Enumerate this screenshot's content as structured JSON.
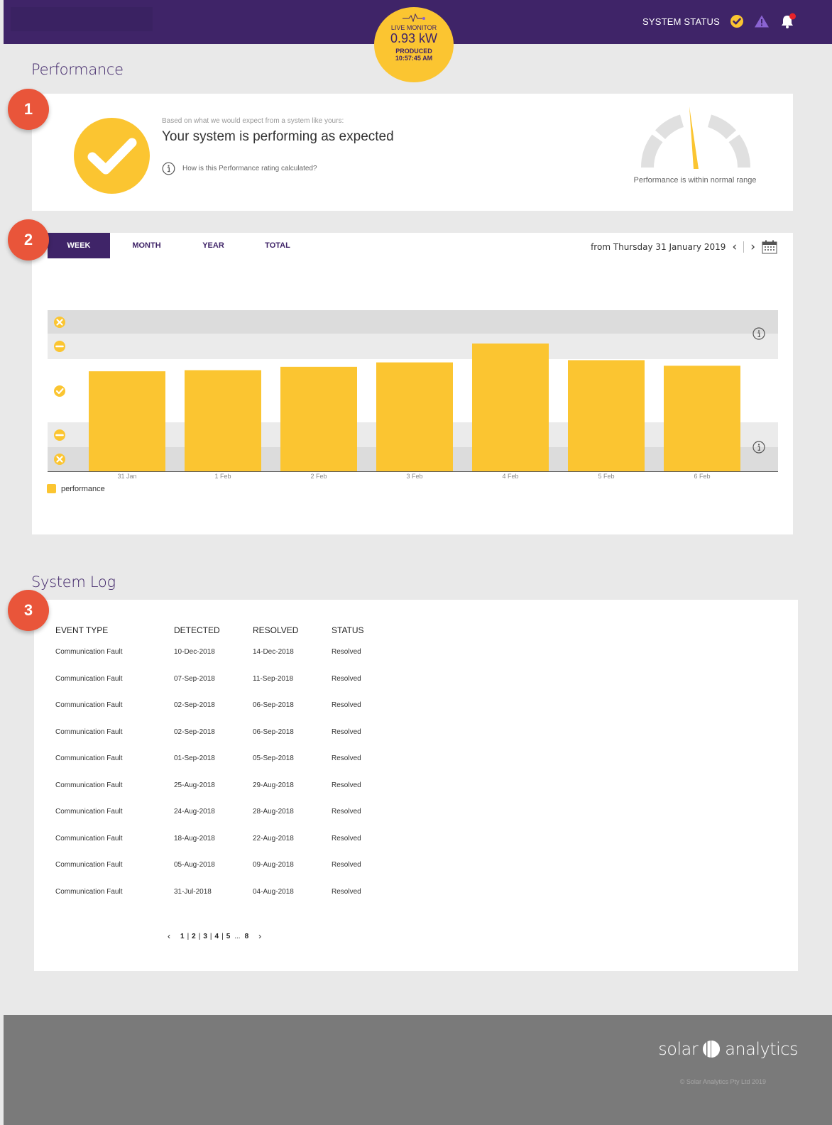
{
  "header": {
    "system_status_label": "SYSTEM STATUS",
    "live_monitor": {
      "label": "LIVE MONITOR",
      "value": "0.93 kW",
      "produced_label": "PRODUCED",
      "time": "10:57:45 AM"
    }
  },
  "performance": {
    "section_title": "Performance",
    "badge": "1",
    "subtitle": "Based on what we would expect from a system like yours:",
    "headline": "Your system is performing as expected",
    "rating_link": "How is this Performance rating calculated?",
    "gauge_caption": "Performance is within normal range"
  },
  "chart_section": {
    "badge": "2",
    "tabs": [
      {
        "label": "WEEK",
        "active": true
      },
      {
        "label": "MONTH",
        "active": false
      },
      {
        "label": "YEAR",
        "active": false
      },
      {
        "label": "TOTAL",
        "active": false
      }
    ],
    "range_text": "from Thursday 31 January 2019",
    "legend": "performance"
  },
  "chart_data": {
    "type": "bar",
    "categories": [
      "31 Jan",
      "1 Feb",
      "2 Feb",
      "3 Feb",
      "4 Feb",
      "5 Feb",
      "6 Feb"
    ],
    "series": [
      {
        "name": "performance",
        "values": [
          0.9,
          0.91,
          0.94,
          0.98,
          1.15,
          1.0,
          0.95
        ]
      }
    ],
    "bands": [
      "poor",
      "below",
      "expected",
      "below",
      "poor"
    ],
    "bands_labeled_on_axis": "status icons (x, minus, check, minus, x)",
    "ylim": [
      0,
      1.45
    ],
    "colors": {
      "bar": "#fbc531",
      "band_outer": "#dcdcdc",
      "band_inner": "#ebebeb"
    },
    "legend": "bottom-left"
  },
  "system_log": {
    "section_title": "System Log",
    "badge": "3",
    "columns": [
      "EVENT TYPE",
      "DETECTED",
      "RESOLVED",
      "STATUS"
    ],
    "rows": [
      [
        "Communication Fault",
        "10-Dec-2018",
        "14-Dec-2018",
        "Resolved"
      ],
      [
        "Communication Fault",
        "07-Sep-2018",
        "11-Sep-2018",
        "Resolved"
      ],
      [
        "Communication Fault",
        "02-Sep-2018",
        "06-Sep-2018",
        "Resolved"
      ],
      [
        "Communication Fault",
        "02-Sep-2018",
        "06-Sep-2018",
        "Resolved"
      ],
      [
        "Communication Fault",
        "01-Sep-2018",
        "05-Sep-2018",
        "Resolved"
      ],
      [
        "Communication Fault",
        "25-Aug-2018",
        "29-Aug-2018",
        "Resolved"
      ],
      [
        "Communication Fault",
        "24-Aug-2018",
        "28-Aug-2018",
        "Resolved"
      ],
      [
        "Communication Fault",
        "18-Aug-2018",
        "22-Aug-2018",
        "Resolved"
      ],
      [
        "Communication Fault",
        "05-Aug-2018",
        "09-Aug-2018",
        "Resolved"
      ],
      [
        "Communication Fault",
        "31-Jul-2018",
        "04-Aug-2018",
        "Resolved"
      ]
    ],
    "pagination": {
      "prev": "‹",
      "pages": [
        "1",
        "2",
        "3",
        "4",
        "5"
      ],
      "ellipsis": "...",
      "last": "8",
      "next": "›"
    }
  },
  "footer": {
    "logo_left": "solar",
    "logo_right": "analytics",
    "copyright": "© Solar Analytics Pty Ltd 2019"
  },
  "colors": {
    "brand_purple": "#3f2468",
    "accent_yellow": "#fbc531",
    "badge_orange": "#e9553a",
    "alert_purple": "#8a63d2",
    "notification_red": "#e8232a"
  }
}
